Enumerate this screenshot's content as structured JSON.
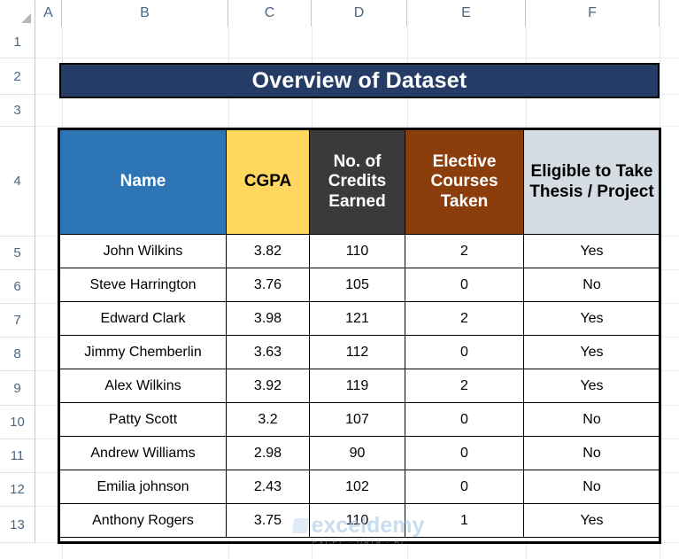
{
  "spreadsheet": {
    "column_headers": [
      "A",
      "B",
      "C",
      "D",
      "E",
      "F"
    ],
    "row_numbers": [
      "1",
      "2",
      "3",
      "4",
      "5",
      "6",
      "7",
      "8",
      "9",
      "10",
      "11",
      "12",
      "13"
    ],
    "select_all_icon": "select-all-triangle-icon"
  },
  "title": {
    "text": "Overview of Dataset",
    "background_color": "#253C66",
    "text_color": "#FFFFFF"
  },
  "table": {
    "headers": [
      {
        "label": "Name",
        "bg": "#2E75B6",
        "fg": "#FFFFFF"
      },
      {
        "label": "CGPA",
        "bg": "#FFD75E",
        "fg": "#000000"
      },
      {
        "label": "No. of Credits Earned",
        "bg": "#3A3A3A",
        "fg": "#FFFFFF"
      },
      {
        "label": "Elective Courses Taken",
        "bg": "#8B3E0C",
        "fg": "#FFFFFF"
      },
      {
        "label": "Eligible to Take Thesis / Project",
        "bg": "#D6DCE4",
        "fg": "#000000"
      }
    ],
    "rows": [
      {
        "name": "John Wilkins",
        "cgpa": "3.82",
        "credits": "110",
        "electives": "2",
        "eligible": "Yes"
      },
      {
        "name": "Steve Harrington",
        "cgpa": "3.76",
        "credits": "105",
        "electives": "0",
        "eligible": "No"
      },
      {
        "name": "Edward Clark",
        "cgpa": "3.98",
        "credits": "121",
        "electives": "2",
        "eligible": "Yes"
      },
      {
        "name": "Jimmy Chemberlin",
        "cgpa": "3.63",
        "credits": "112",
        "electives": "0",
        "eligible": "Yes"
      },
      {
        "name": "Alex Wilkins",
        "cgpa": "3.92",
        "credits": "119",
        "electives": "2",
        "eligible": "Yes"
      },
      {
        "name": "Patty Scott",
        "cgpa": "3.2",
        "credits": "107",
        "electives": "0",
        "eligible": "No"
      },
      {
        "name": "Andrew Williams",
        "cgpa": "2.98",
        "credits": "90",
        "electives": "0",
        "eligible": "No"
      },
      {
        "name": "Emilia johnson",
        "cgpa": "2.43",
        "credits": "102",
        "electives": "0",
        "eligible": "No"
      },
      {
        "name": "Anthony Rogers",
        "cgpa": "3.75",
        "credits": "110",
        "electives": "1",
        "eligible": "Yes"
      }
    ]
  },
  "watermark": {
    "brand": "exceldemy",
    "tagline": "EXCEL · DATA · BI"
  }
}
